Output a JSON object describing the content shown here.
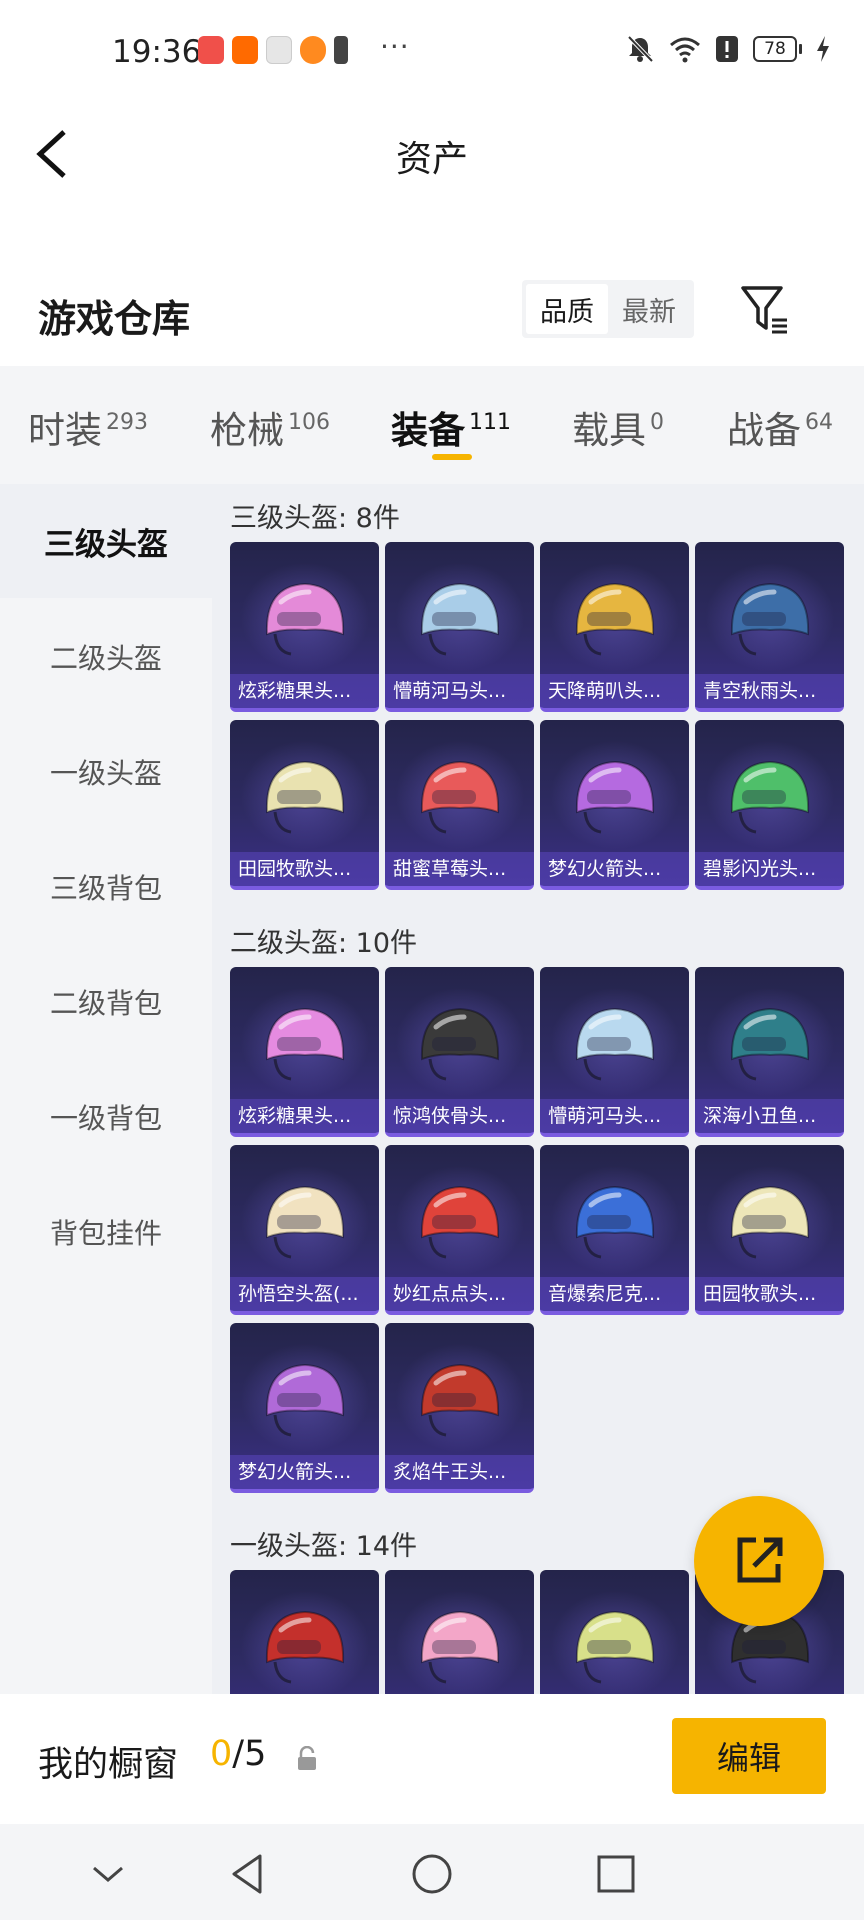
{
  "status_bar": {
    "time": "19:36",
    "more": "···",
    "battery": "78",
    "app_icon_colors": [
      "#f0504a",
      "#ff6a00",
      "#e0e0e0",
      "#ff8a1f",
      "#444444"
    ]
  },
  "header": {
    "title": "资产",
    "back_icon": "chevron-left-icon"
  },
  "warehouse": {
    "title": "游戏仓库",
    "sort_options": [
      "品质",
      "最新"
    ],
    "sort_selected": "品质",
    "filter_icon": "filter-icon"
  },
  "tabs": [
    {
      "label": "时装",
      "count": "293"
    },
    {
      "label": "枪械",
      "count": "106"
    },
    {
      "label": "装备",
      "count": "111",
      "active": true
    },
    {
      "label": "载具",
      "count": "0"
    },
    {
      "label": "战备",
      "count": "64"
    }
  ],
  "sidebar": {
    "items": [
      "三级头盔",
      "二级头盔",
      "一级头盔",
      "三级背包",
      "二级背包",
      "一级背包",
      "背包挂件"
    ],
    "active": "三级头盔"
  },
  "sections": [
    {
      "title": "三级头盔: 8件",
      "items": [
        {
          "name": "炫彩糖果头...",
          "color": "#e48ad8"
        },
        {
          "name": "懵萌河马头...",
          "color": "#a9cde8"
        },
        {
          "name": "天降萌叭头...",
          "color": "#e6b640"
        },
        {
          "name": "青空秋雨头...",
          "color": "#3d6ea8"
        },
        {
          "name": "田园牧歌头...",
          "color": "#e9e2b0"
        },
        {
          "name": "甜蜜草莓头...",
          "color": "#e85a5a"
        },
        {
          "name": "梦幻火箭头...",
          "color": "#b56ae0"
        },
        {
          "name": "碧影闪光头...",
          "color": "#4fbf6a"
        }
      ]
    },
    {
      "title": "二级头盔: 10件",
      "items": [
        {
          "name": "炫彩糖果头...",
          "color": "#e58be0"
        },
        {
          "name": "惊鸿侠骨头...",
          "color": "#3a3a3a"
        },
        {
          "name": "懵萌河马头...",
          "color": "#b9d9ef"
        },
        {
          "name": "深海小丑鱼...",
          "color": "#2f7f8a"
        },
        {
          "name": "孙悟空头盔(...",
          "color": "#f1e2c0"
        },
        {
          "name": "妙红点点头...",
          "color": "#e0433a"
        },
        {
          "name": "音爆索尼克...",
          "color": "#3b6fd8"
        },
        {
          "name": "田园牧歌头...",
          "color": "#ede6b8"
        },
        {
          "name": "梦幻火箭头...",
          "color": "#b06ad8"
        },
        {
          "name": "炙焰牛王头...",
          "color": "#c23a2c"
        }
      ]
    },
    {
      "title": "一级头盔: 14件",
      "items": [
        {
          "name": "",
          "color": "#c4302c"
        },
        {
          "name": "",
          "color": "#f3a6c8"
        },
        {
          "name": "",
          "color": "#d8e08a"
        },
        {
          "name": "",
          "color": "#2f2f2f"
        }
      ]
    }
  ],
  "fab": {
    "icon": "share-icon"
  },
  "showcase": {
    "label": "我的橱窗",
    "current": "0",
    "total": "/5",
    "edit_label": "编辑"
  },
  "nav": {
    "icons": [
      "chevron-down-icon",
      "back-triangle-icon",
      "home-circle-icon",
      "recents-square-icon"
    ]
  }
}
